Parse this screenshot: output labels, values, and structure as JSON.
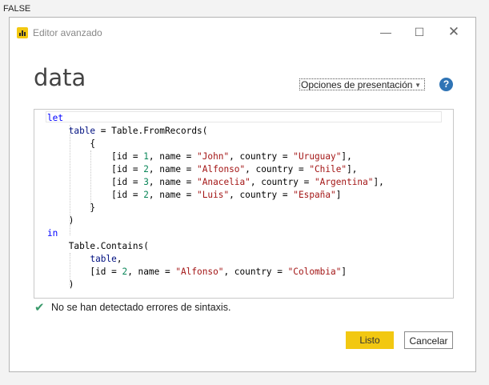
{
  "background_label": "FALSE",
  "window": {
    "title": "Editor avanzado",
    "min_glyph": "—",
    "max_glyph": "☐",
    "close_glyph": "✕"
  },
  "query_name": "data",
  "options_dropdown": {
    "label": "Opciones de presentación",
    "caret": "▼"
  },
  "help_glyph": "?",
  "status": {
    "check": "✔",
    "message": "No se han detectado errores de sintaxis."
  },
  "buttons": {
    "ok": "Listo",
    "cancel": "Cancelar"
  },
  "colors": {
    "accent": "#f2c811",
    "keyword": "#0000ff",
    "string": "#a31515",
    "number": "#098658",
    "check": "#3a9a6b",
    "help": "#2f74b5"
  },
  "icons": {
    "app": "power-bi-icon",
    "help": "help-icon",
    "status": "checkmark-icon"
  },
  "code_lines": [
    [
      [
        "kw",
        "let"
      ]
    ],
    [
      [
        "t",
        "    "
      ],
      [
        "vr",
        "table"
      ],
      [
        "t",
        " = Table.FromRecords("
      ]
    ],
    [
      [
        "t",
        "        {"
      ]
    ],
    [
      [
        "t",
        "            [id = "
      ],
      [
        "num",
        "1"
      ],
      [
        "t",
        ", name = "
      ],
      [
        "str",
        "\"John\""
      ],
      [
        "t",
        ", country = "
      ],
      [
        "str",
        "\"Uruguay\""
      ],
      [
        "t",
        "],"
      ]
    ],
    [
      [
        "t",
        "            [id = "
      ],
      [
        "num",
        "2"
      ],
      [
        "t",
        ", name = "
      ],
      [
        "str",
        "\"Alfonso\""
      ],
      [
        "t",
        ", country = "
      ],
      [
        "str",
        "\"Chile\""
      ],
      [
        "t",
        "],"
      ]
    ],
    [
      [
        "t",
        "            [id = "
      ],
      [
        "num",
        "3"
      ],
      [
        "t",
        ", name = "
      ],
      [
        "str",
        "\"Anacelia\""
      ],
      [
        "t",
        ", country = "
      ],
      [
        "str",
        "\"Argentina\""
      ],
      [
        "t",
        "],"
      ]
    ],
    [
      [
        "t",
        "            [id = "
      ],
      [
        "num",
        "2"
      ],
      [
        "t",
        ", name = "
      ],
      [
        "str",
        "\"Luis\""
      ],
      [
        "t",
        ", country = "
      ],
      [
        "str",
        "\"España\""
      ],
      [
        "t",
        "]"
      ]
    ],
    [
      [
        "t",
        "        }"
      ]
    ],
    [
      [
        "t",
        "    )"
      ]
    ],
    [
      [
        "kw",
        "in"
      ]
    ],
    [
      [
        "t",
        "    Table.Contains("
      ]
    ],
    [
      [
        "t",
        "        "
      ],
      [
        "vr",
        "table"
      ],
      [
        "t",
        ","
      ]
    ],
    [
      [
        "t",
        "        [id = "
      ],
      [
        "num",
        "2"
      ],
      [
        "t",
        ", name = "
      ],
      [
        "str",
        "\"Alfonso\""
      ],
      [
        "t",
        ", country = "
      ],
      [
        "str",
        "\"Colombia\""
      ],
      [
        "t",
        "]"
      ]
    ],
    [
      [
        "t",
        "    )"
      ]
    ]
  ]
}
